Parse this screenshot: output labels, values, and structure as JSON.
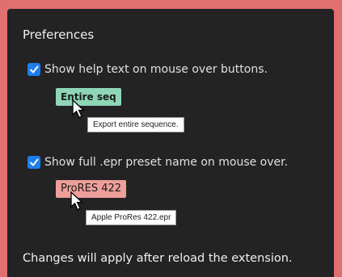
{
  "panel": {
    "title": "Preferences"
  },
  "options": [
    {
      "label": "Show help text on mouse over buttons.",
      "checked": true,
      "demo_button": "Entire seq",
      "tooltip": "Export entire sequence."
    },
    {
      "label": "Show full .epr preset name on mouse over.",
      "checked": true,
      "demo_button": "ProRES 422",
      "tooltip": "Apple ProRes 422.epr"
    }
  ],
  "footer": {
    "note": "Changes will apply after reload the extension."
  },
  "colors": {
    "frame": "#e07070",
    "panel_bg": "#232323",
    "checkbox": "#1e7ef0",
    "demo_green": "#8fd6b6",
    "demo_pink": "#ef9f9a"
  },
  "icons": {
    "checkbox": "checkmark-icon",
    "pointer": "mouse-pointer-icon"
  }
}
